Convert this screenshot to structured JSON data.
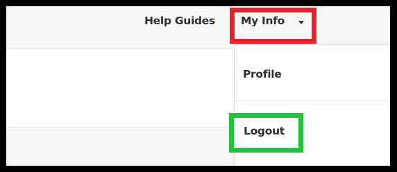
{
  "header": {
    "help_guides_label": "Help Guides",
    "my_info_label": "My Info"
  },
  "user_menu": {
    "items": [
      {
        "label": "Profile"
      },
      {
        "label": "Logout"
      }
    ]
  },
  "annotations": {
    "my_info_highlight_color": "#e8212a",
    "logout_highlight_color": "#22c33b"
  }
}
